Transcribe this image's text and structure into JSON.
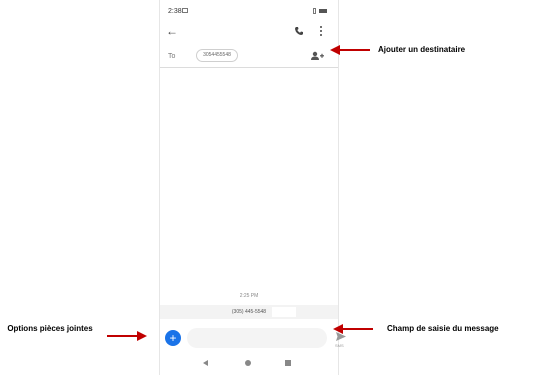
{
  "status_bar": {
    "time": "2:38"
  },
  "recipient": {
    "to_label": "To",
    "phone": "3054455548"
  },
  "conversation": {
    "timestamp": "2:25 PM",
    "sender_number": "(305) 445-5548"
  },
  "composer": {
    "send_label": "SMS"
  },
  "annotations": {
    "add_recipient": "Ajouter un destinataire",
    "attachment_options": "Options pièces jointes",
    "message_field": "Champ de saisie du message"
  },
  "colors": {
    "accent": "#1a73e8",
    "arrow": "#c00000"
  },
  "icons": [
    "back-arrow-icon",
    "phone-icon",
    "more-vert-icon",
    "add-contact-icon",
    "add-icon",
    "send-icon",
    "nav-back-icon",
    "nav-home-icon",
    "nav-recent-icon"
  ]
}
